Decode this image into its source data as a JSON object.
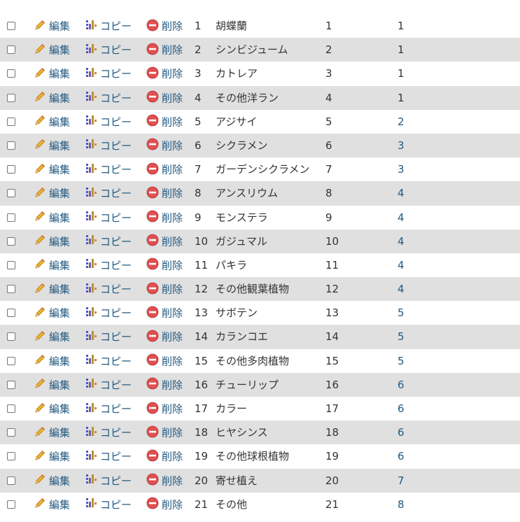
{
  "actions": {
    "edit_label": "編集",
    "copy_label": "コピー",
    "delete_label": "削除"
  },
  "colors": {
    "row_alt": "#e0e0e0",
    "link": "#235a81",
    "delete_icon": "#e05050",
    "edit_icon": "#f0b030"
  },
  "icons": {
    "edit": "pencil-icon",
    "copy": "copy-insert-icon",
    "delete": "delete-circle-icon"
  },
  "rows": [
    {
      "id": "1",
      "name": "胡蝶蘭",
      "order": "1",
      "category": "1"
    },
    {
      "id": "2",
      "name": "シンビジューム",
      "order": "2",
      "category": "1"
    },
    {
      "id": "3",
      "name": "カトレア",
      "order": "3",
      "category": "1"
    },
    {
      "id": "4",
      "name": "その他洋ラン",
      "order": "4",
      "category": "1"
    },
    {
      "id": "5",
      "name": "アジサイ",
      "order": "5",
      "category": "2"
    },
    {
      "id": "6",
      "name": "シクラメン",
      "order": "6",
      "category": "3"
    },
    {
      "id": "7",
      "name": "ガーデンシクラメン",
      "order": "7",
      "category": "3"
    },
    {
      "id": "8",
      "name": "アンスリウム",
      "order": "8",
      "category": "4"
    },
    {
      "id": "9",
      "name": "モンステラ",
      "order": "9",
      "category": "4"
    },
    {
      "id": "10",
      "name": "ガジュマル",
      "order": "10",
      "category": "4"
    },
    {
      "id": "11",
      "name": "パキラ",
      "order": "11",
      "category": "4"
    },
    {
      "id": "12",
      "name": "その他観葉植物",
      "order": "12",
      "category": "4"
    },
    {
      "id": "13",
      "name": "サボテン",
      "order": "13",
      "category": "5"
    },
    {
      "id": "14",
      "name": "カランコエ",
      "order": "14",
      "category": "5"
    },
    {
      "id": "15",
      "name": "その他多肉植物",
      "order": "15",
      "category": "5"
    },
    {
      "id": "16",
      "name": "チューリップ",
      "order": "16",
      "category": "6"
    },
    {
      "id": "17",
      "name": "カラー",
      "order": "17",
      "category": "6"
    },
    {
      "id": "18",
      "name": "ヒヤシンス",
      "order": "18",
      "category": "6"
    },
    {
      "id": "19",
      "name": "その他球根植物",
      "order": "19",
      "category": "6"
    },
    {
      "id": "20",
      "name": "寄せ植え",
      "order": "20",
      "category": "7"
    },
    {
      "id": "21",
      "name": "その他",
      "order": "21",
      "category": "8"
    }
  ]
}
